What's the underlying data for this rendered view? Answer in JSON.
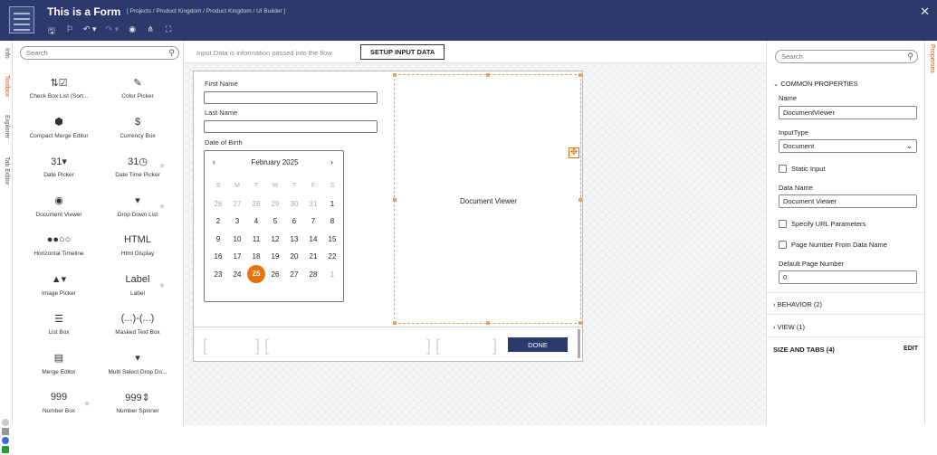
{
  "header": {
    "title": "This is a Form",
    "breadcrumb": "[ Projects / Product Kingdom / Product Kingdom / UI Builder ]",
    "toolbar": {
      "save": "🖫",
      "flag": "⚐",
      "undo": "↶ ▾",
      "redo": "↷ ▾",
      "preview": "◉",
      "share": "⋔",
      "fullscreen": "⛶"
    },
    "close": "✕"
  },
  "left_tabs": [
    "Info",
    "Toolbox",
    "Explorer",
    "Tab Editor"
  ],
  "toolbox": {
    "search_placeholder": "Search",
    "items": [
      {
        "label": "Check Box List (Sort...",
        "icon": "⇅☑",
        "name": "check-box-list-icon"
      },
      {
        "label": "Color Picker",
        "icon": "✎",
        "name": "color-picker-icon"
      },
      {
        "label": "Compact Merge Editor",
        "icon": "⬢",
        "name": "cube-icon"
      },
      {
        "label": "Currency Box",
        "icon": "$",
        "name": "currency-icon"
      },
      {
        "label": "Date Picker",
        "icon": "31▾",
        "name": "calendar-icon"
      },
      {
        "label": "Date Time Picker",
        "icon": "31◷",
        "name": "calendar-clock-icon"
      },
      {
        "label": "Document Viewer",
        "icon": "◉",
        "name": "document-eye-icon"
      },
      {
        "label": "Drop Down List",
        "icon": "▾",
        "name": "dropdown-icon"
      },
      {
        "label": "Horizontal Timeline",
        "icon": "●●○○",
        "name": "timeline-icon"
      },
      {
        "label": "Html Display",
        "icon": "HTML",
        "name": "html-icon"
      },
      {
        "label": "Image Picker",
        "icon": "▲▾",
        "name": "image-icon"
      },
      {
        "label": "Label",
        "icon": "Label",
        "name": "label-icon"
      },
      {
        "label": "List Box",
        "icon": "☰",
        "name": "list-box-icon"
      },
      {
        "label": "Masked Text Box",
        "icon": "(...)-(...)",
        "name": "masked-text-icon"
      },
      {
        "label": "Merge Editor",
        "icon": "▤",
        "name": "merge-editor-icon"
      },
      {
        "label": "Multi Select Drop Do...",
        "icon": "▾",
        "name": "multi-select-icon"
      },
      {
        "label": "Number Box",
        "icon": "999",
        "name": "number-box-icon"
      },
      {
        "label": "Number Spinner",
        "icon": "999⇕",
        "name": "number-spinner-icon"
      }
    ]
  },
  "canvas_bar": {
    "message": "Input Data is information passed into the flow",
    "setup_button": "SETUP INPUT DATA"
  },
  "form": {
    "first_name_label": "First Name",
    "last_name_label": "Last Name",
    "dob_label": "Date of Birth",
    "calendar": {
      "month": "February 2025",
      "prev": "‹",
      "next": "›",
      "dow": [
        "S",
        "M",
        "T",
        "W",
        "T",
        "F",
        "S"
      ],
      "weeks": [
        [
          "26",
          "27",
          "28",
          "29",
          "30",
          "31",
          "1"
        ],
        [
          "2",
          "3",
          "4",
          "5",
          "6",
          "7",
          "8"
        ],
        [
          "9",
          "10",
          "11",
          "12",
          "13",
          "14",
          "15"
        ],
        [
          "16",
          "17",
          "18",
          "19",
          "20",
          "21",
          "22"
        ],
        [
          "23",
          "24",
          "25",
          "26",
          "27",
          "28",
          "1"
        ]
      ],
      "muted": [
        [
          0,
          0
        ],
        [
          0,
          1
        ],
        [
          0,
          2
        ],
        [
          0,
          3
        ],
        [
          0,
          4
        ],
        [
          0,
          5
        ],
        [
          4,
          6
        ]
      ],
      "selected": [
        4,
        2
      ]
    },
    "document_viewer_label": "Document Viewer",
    "done_button": "DONE"
  },
  "properties": {
    "tab": "Properties",
    "search_placeholder": "Search",
    "common_title": "COMMON PROPERTIES",
    "name_label": "Name",
    "name_value": "DocumentViewer",
    "input_type_label": "InputType",
    "input_type_value": "Document",
    "static_input": "Static Input",
    "data_name_label": "Data Name",
    "data_name_value": "Document Viewer",
    "specify_url": "Specify URL Parameters",
    "page_number_from_data": "Page Number From Data Name",
    "default_page_label": "Default Page Number",
    "default_page_value": "0",
    "behavior": "BEHAVIOR (2)",
    "view": "VIEW (1)",
    "size_tabs": "SIZE AND TABS (4)",
    "edit": "EDIT"
  },
  "colors": {
    "header": "#2b3a6b",
    "accent": "#e8720c",
    "tab_active": "#d9531e"
  }
}
